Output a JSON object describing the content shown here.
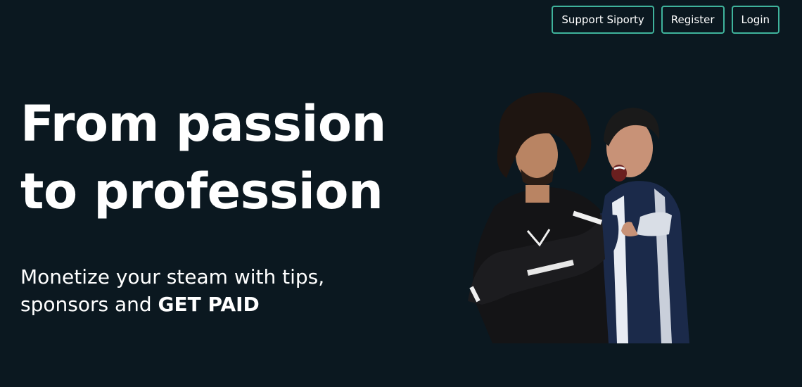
{
  "nav": {
    "support_label": "Support Siporty",
    "register_label": "Register",
    "login_label": "Login"
  },
  "hero": {
    "title_line1": "From passion",
    "title_line2": "to profession",
    "subtitle_line1": "Monetize your steam with tips,",
    "subtitle_line2_prefix": "sponsors and ",
    "subtitle_line2_emphasis": "GET PAID"
  },
  "colors": {
    "background": "#0b1820",
    "accent": "#3fb39c",
    "text": "#ffffff"
  }
}
